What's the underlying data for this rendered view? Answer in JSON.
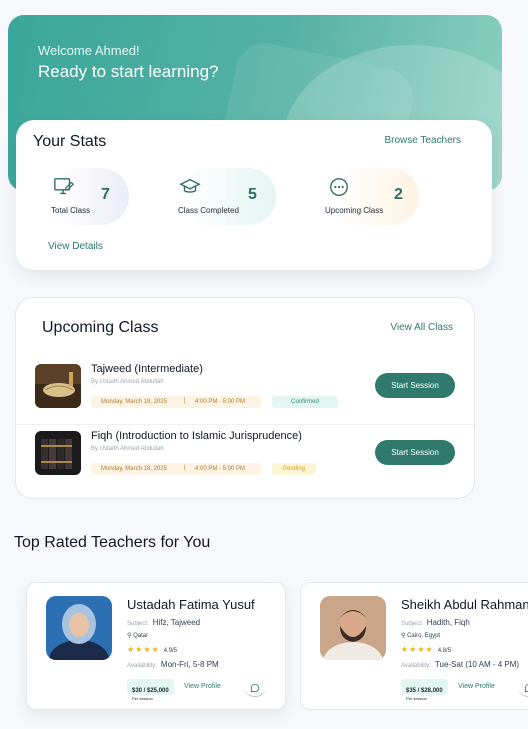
{
  "hero": {
    "welcome": "Welcome Ahmed!",
    "tagline": "Ready to start learning?"
  },
  "stats": {
    "title": "Your Stats",
    "browse_link": "Browse Teachers",
    "items": [
      {
        "label": "Total Class",
        "value": "7",
        "icon": "monitor-pen-icon"
      },
      {
        "label": "Class Completed",
        "value": "5",
        "icon": "graduation-cap-icon"
      },
      {
        "label": "Upcoming Class",
        "value": "2",
        "icon": "more-dots-icon"
      }
    ],
    "view_details": "View Details"
  },
  "upcoming": {
    "title": "Upcoming Class",
    "view_all": "View All Class",
    "classes": [
      {
        "name": "Tajweed (Intermediate)",
        "teacher": "By Ustadh Ahmed Abdullah",
        "date": "Monday, March 18, 2025",
        "separator": "|",
        "time": "4:00 PM - 5:00 PM",
        "status": "Confirmed",
        "button": "Start Session"
      },
      {
        "name": "Fiqh (Introduction to Islamic Jurisprudence)",
        "teacher": "By Ustadh Ahmed Abdullah",
        "date": "Monday, March 18, 2025",
        "separator": "|",
        "time": "4:00 PM - 5:00 PM",
        "status": "Pending",
        "button": "Start Session"
      }
    ]
  },
  "top_teachers": {
    "title": "Top Rated Teachers for You",
    "teachers": [
      {
        "name": "Ustadah Fatima Yusuf",
        "subject_label": "Subject:",
        "subject": "Hifz, Tajweed",
        "location": "Qatar",
        "stars": "★★★★",
        "rating": "4.9/5",
        "availability_label": "Availability:",
        "availability": "Mon-Fri, 5-8 PM",
        "price": "$30 / $25,000",
        "price_unit": "Per session",
        "view_profile": "View Profile"
      },
      {
        "name": "Sheikh Abdul Rahman",
        "subject_label": "Subject:",
        "subject": "Hadith, Fiqh",
        "location": "Cairo, Egypt",
        "stars": "★★★★",
        "rating": "4.8/5",
        "availability_label": "Availability:",
        "availability": "Tue-Sat (10 AM - 4 PM)",
        "price": "$35 / $28,000",
        "price_unit": "Per session",
        "view_profile": "View Profile"
      }
    ]
  },
  "colors": {
    "brand": "#2f7a6d",
    "hero": "#3aa79a",
    "confirmed": "#2f8a74",
    "pending": "#d4a017",
    "star": "#f5b014"
  }
}
